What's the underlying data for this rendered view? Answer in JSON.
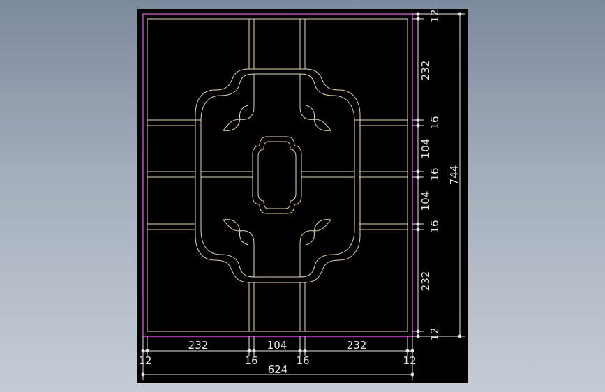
{
  "drawing": {
    "background_color": "#000000",
    "outline_color": "#c837c8",
    "pattern_color": "#e8d7a0",
    "dim_color": "#e6e6e6",
    "dimensions": {
      "right_segments": [
        "12",
        "232",
        "16",
        "104",
        "16",
        "104",
        "16",
        "232",
        "12"
      ],
      "overall_height": "744",
      "bottom_segments": [
        "12",
        "232",
        "16",
        "104",
        "16",
        "232",
        "12"
      ],
      "overall_width": "624"
    }
  }
}
